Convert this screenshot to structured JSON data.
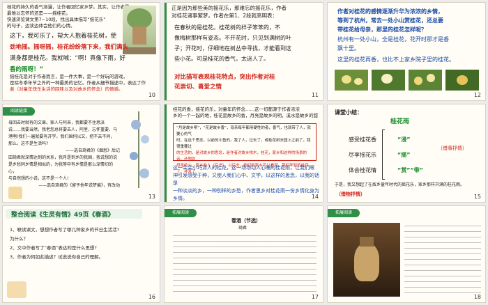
{
  "slides": [
    {
      "num": "10",
      "lines": [
        "桂花的持久的香气溶漫，让作者回忆家乡梦。其实，让作者最",
        "最难以忘怀的还是——摇桂花。",
        "快速浏览课文第7~10段，找出具体描写“摇花乐”",
        "的句子，边读边体会他们的心情。"
      ],
      "body": [
        "这下，我可乐了，帮大人抱着桂花树，使",
        "劲地摇。摇呀摇，桂花纷纷落下来，我们满头",
        "满身都是桂花。我就喊：“啊！真像下雨，好",
        "香的雨呀！”",
        "摇桂花是对于作者而言，是一件大事，是一个好玩的游戏，",
        "是除冬季年节之外的一种最美的记忆。作者从细节描述中，表达了作",
        "者（对童年快乐生活的回味以及对故乡的怀念）的情感。"
      ]
    },
    {
      "num": "11",
      "lines": [
        "正是因为那些美的摇花乐，那难忘的摇花乐，作者",
        "对桂花诸事萦梦。作者在第1、2段就高明表：",
        "在春秋的是桂花。桂花树的样子笨笨的，不",
        "像梅树那样有姿态。不开花时，只见到满树的叶",
        "子；开花时，仔细地在树丛中寻找，才能看到这",
        "些小花。可是桂花的香气，太迷人了。",
        "对比描写表现桂花特点，突出作者对桂",
        "花崇切、喜爱之情"
      ]
    },
    {
      "num": "12",
      "lines": [
        "作者对桂花的感情逐渐升华为浓浓的乡情，",
        "等到了杭州，常去一处小山赏桂花，还总要",
        "带桂花给母亲，那里的桂花怎样呢？",
        "杭州有一处小山，全是桂花，花开时那才是香",
        "飘十里。",
        "这里的桂花再香，也比不上家乡院子里的桂花。"
      ]
    },
    {
      "num": "13",
      "tab": "阅读链接",
      "lines": [
        "母回去时就有的文章。家人与阿来，我都要不住思派",
        "说……我要当然，我老您总将要去人，阿里，忘怀重要，马",
        "港啊!我们一遍就要有开学，我们国何以又，把不去不同，",
        "那么，这不是生活吗?",
        "——选自琦君的《烟愁》后记",
        "田琦君就深情达到的关系，我月是到乡的我国，我说想的说",
        "是乡愁同乡情是相似的，为我等中有乡情是那么深情切的心，",
        "与自然想的小说，这不是一个人!",
        "——选自琦君的《留予他年说梦痕》，有改动"
      ]
    },
    {
      "num": "14",
      "lines": [
        "桂花的香，摇花的乐，对童年的怀念……这一切都源于作者浓浓",
        "乡的一个一起的地，桂花是故乡的香，月亮是故乡的明，溪水是故乡的甜",
        "“月是故乡明”，“花是故乡香”，母亲每年都用硬性的者，香气，也就带了人，就要心的气",
        "时，在这个思念，以前的小鱼的，我了人，过去了，或桂花树去园上之前了，我很重要过",
        "的生活的，是对故乡的思念，是作者对故乡桃木，桂花，家乡和这样的场景的话，还想到",
        "母亲的心，家乡的人（后书），以后去，他们的家乡可以看到，我们年轻的桂花了，并来了",
        "这一朵朵小巧清人的桂花，这一场场动人心魄的桂花雨，让我们眼",
        "神引发感受于种，又使人我们心中、文学，以这样的思念，以我的话是",
        "一种淡淡的乡，一种别样的乡愁，作者思乡对桂花雨一份乡情化身为乡情。"
      ]
    },
    {
      "num": "15",
      "title": "课堂小结：",
      "topic": "桂花雨",
      "rows": [
        {
          "k": "感受桂花香",
          "v": "“浸”"
        },
        {
          "k": "尽享摇花乐",
          "v": "“摇”"
        },
        {
          "k": "体会桂花情",
          "v": "“赏”“带”"
        }
      ],
      "foot": "于是，我又想起了在故乡童年时代的摇花乐，家乡那样开满的桂花雨。",
      "side": "（借物抒情）",
      "side2": "（借事抒情）"
    },
    {
      "num": "16",
      "tab": "整合阅读《生灵有情》49页《春酒》",
      "q": [
        "1、联读课文，想想作者写了哪几种家乡的节日生活活?",
        "为什么？",
        "2、文中作者写了“春酒”表达的是什么思想?",
        "3、作者为何如此描述？试说说你自己的理解。"
      ]
    },
    {
      "num": "17",
      "tab": "拓展阅读",
      "title": "春酒（节选）",
      "author": "琦君"
    },
    {
      "num": "18",
      "tab": "拓展阅读"
    }
  ],
  "colors": {
    "green": "#2f8f48",
    "red": "#d0221a",
    "blue": "#1a4aa8"
  }
}
